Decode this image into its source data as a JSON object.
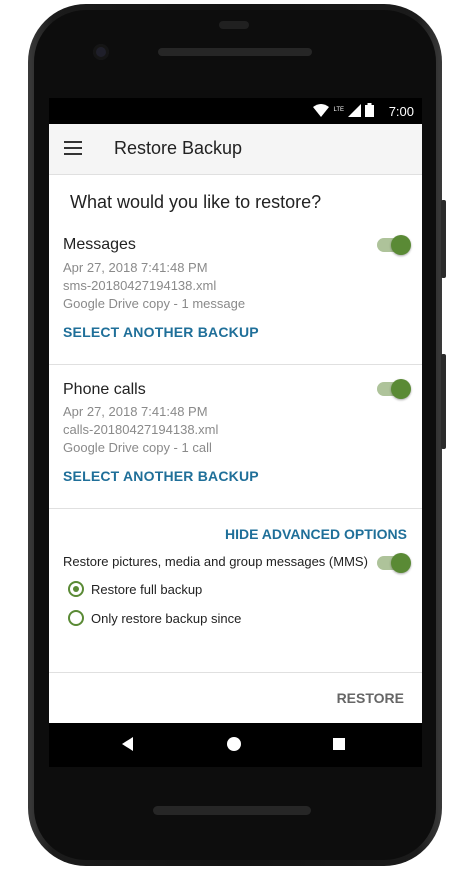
{
  "status_bar": {
    "time": "7:00",
    "network": "LTE"
  },
  "app_bar": {
    "title": "Restore Backup",
    "menu_icon": "hamburger-menu-icon"
  },
  "main": {
    "question": "What would you like to restore?",
    "messages": {
      "title": "Messages",
      "date": "Apr 27, 2018 7:41:48 PM",
      "file": "sms-20180427194138.xml",
      "source": "Google Drive copy - 1 message",
      "link": "SELECT ANOTHER BACKUP",
      "enabled": true
    },
    "calls": {
      "title": "Phone calls",
      "date": "Apr 27, 2018 7:41:48 PM",
      "file": "calls-20180427194138.xml",
      "source": "Google Drive copy - 1 call",
      "link": "SELECT ANOTHER BACKUP",
      "enabled": true
    },
    "advanced": {
      "link": "HIDE ADVANCED OPTIONS",
      "mms_label": "Restore pictures, media and group messages (MMS)",
      "mms_enabled": true,
      "options": [
        {
          "label": "Restore full backup",
          "selected": true
        },
        {
          "label": "Only restore backup since",
          "selected": false
        }
      ]
    }
  },
  "footer": {
    "restore_label": "RESTORE"
  },
  "colors": {
    "accent_green": "#5a8a35",
    "link_blue": "#1f6f99"
  }
}
